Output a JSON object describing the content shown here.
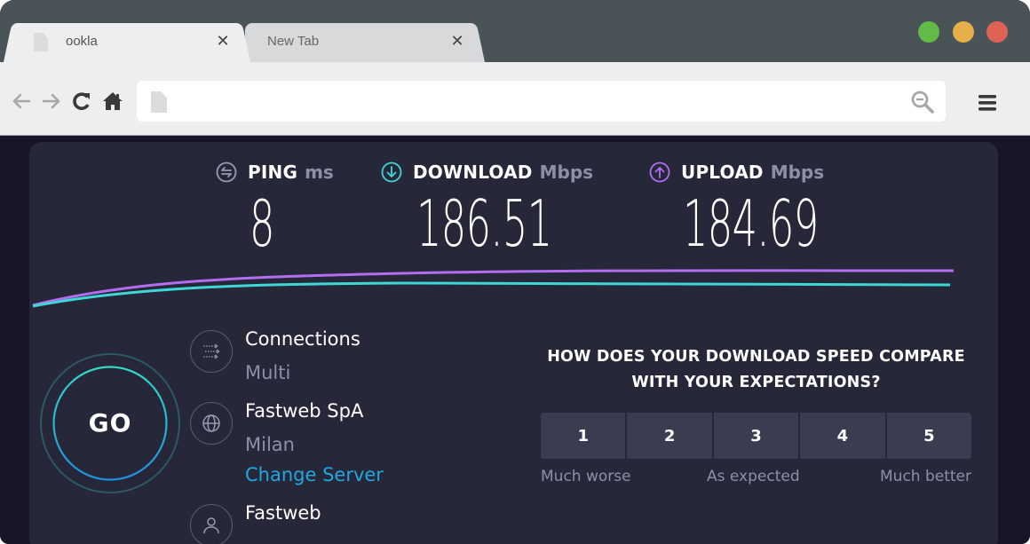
{
  "browser": {
    "tabs": [
      {
        "title": "ookla",
        "active": true
      },
      {
        "title": "New Tab",
        "active": false
      }
    ],
    "tab_close_glyph": "✕",
    "url": {
      "value": "",
      "placeholder": ""
    },
    "icons": [
      "back-arrow-icon",
      "forward-arrow-icon",
      "reload-icon",
      "home-icon",
      "document-icon",
      "zoom-out-icon",
      "hamburger-menu-icon"
    ],
    "window_controls": {
      "green": "#62bb47",
      "yellow": "#e5ae48",
      "red": "#de6156"
    }
  },
  "speedtest": {
    "ping": {
      "label": "PING",
      "unit": "ms",
      "value": "8",
      "icon": "ping-icon",
      "color": "#9a9bb0"
    },
    "download": {
      "label": "DOWNLOAD",
      "unit": "Mbps",
      "value": "186.51",
      "icon": "download-icon",
      "color": "#3fd6d6"
    },
    "upload": {
      "label": "UPLOAD",
      "unit": "Mbps",
      "value": "184.69",
      "icon": "upload-icon",
      "color": "#b36ef0"
    },
    "go_label": "GO",
    "connections": {
      "title": "Connections",
      "value": "Multi"
    },
    "server": {
      "title": "Fastweb SpA",
      "location": "Milan",
      "change_link": "Change Server"
    },
    "isp": {
      "title": "Fastweb"
    },
    "survey": {
      "question_line1": "HOW DOES YOUR DOWNLOAD SPEED COMPARE",
      "question_line2": "WITH YOUR EXPECTATIONS?",
      "options": [
        "1",
        "2",
        "3",
        "4",
        "5"
      ],
      "label_low": "Much worse",
      "label_mid": "As expected",
      "label_high": "Much better"
    },
    "accent_link": "#1fa8e0"
  }
}
